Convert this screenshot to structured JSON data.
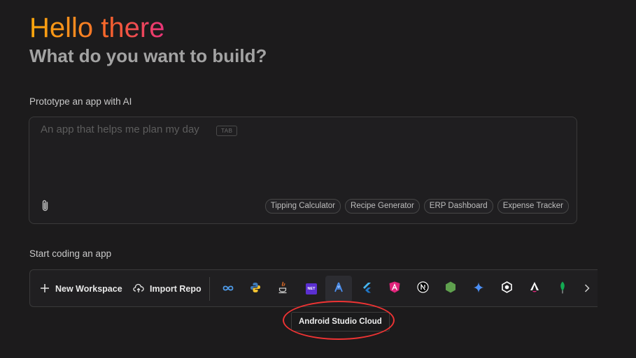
{
  "hero": {
    "title": "Hello there",
    "subtitle": "What do you want to build?"
  },
  "prototype": {
    "section_label": "Prototype an app with AI",
    "placeholder": "An app that helps me plan my day",
    "tab_hint": "TAB",
    "attach_icon": "paperclip-icon",
    "suggestions": [
      "Tipping Calculator",
      "Recipe Generator",
      "ERP Dashboard",
      "Expense Tracker"
    ]
  },
  "coding": {
    "section_label": "Start coding an app",
    "new_workspace_label": "New Workspace",
    "import_repo_label": "Import Repo",
    "templates": [
      {
        "icon": "infinity-icon",
        "color": "#4f9be8"
      },
      {
        "icon": "python-icon",
        "color": "#3d7ab8"
      },
      {
        "icon": "java-icon",
        "color": "#e06b26"
      },
      {
        "icon": "dotnet-icon",
        "color": "#5b2fd1",
        "text": "NET"
      },
      {
        "icon": "android-studio-icon",
        "color": "#4a8ff0"
      },
      {
        "icon": "flutter-icon",
        "color": "#47b5f0"
      },
      {
        "icon": "angular-icon",
        "color": "#e0237a"
      },
      {
        "icon": "nextjs-icon",
        "color": "#ffffff"
      },
      {
        "icon": "nodejs-icon",
        "color": "#5fa04e"
      },
      {
        "icon": "gemini-icon",
        "color": "#4b8ff5"
      },
      {
        "icon": "hexagon-icon",
        "color": "#ffffff"
      },
      {
        "icon": "astro-icon",
        "color": "#ffffff"
      },
      {
        "icon": "mongodb-icon",
        "color": "#13aa52"
      }
    ],
    "active_template_index": 4,
    "scroll_right_icon": "chevron-right-icon",
    "tooltip": "Android Studio Cloud"
  },
  "annotation": {
    "color": "#e33333"
  }
}
